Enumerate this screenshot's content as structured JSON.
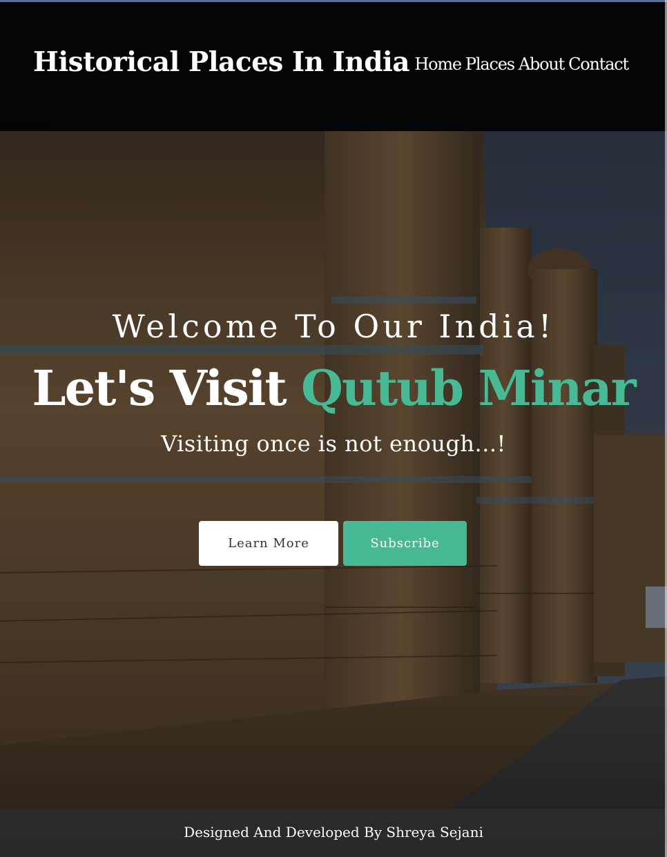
{
  "header": {
    "brand": "Historical Places In India",
    "nav": [
      "Home",
      "Places",
      "About",
      "Contact"
    ]
  },
  "hero": {
    "welcome": "Welcome To Our India!",
    "headline_lead": "Let's Visit",
    "headline_accent": "Qutub Minar",
    "tagline": "Visiting once is not enough...!",
    "learn_more_label": "Learn More",
    "subscribe_label": "Subscribe"
  },
  "footer": {
    "credit": "Designed And Developed By Shreya Sejani"
  },
  "colors": {
    "accent": "#47b994",
    "header_bg": "#000000",
    "footer_bg": "#2d2d2d"
  }
}
